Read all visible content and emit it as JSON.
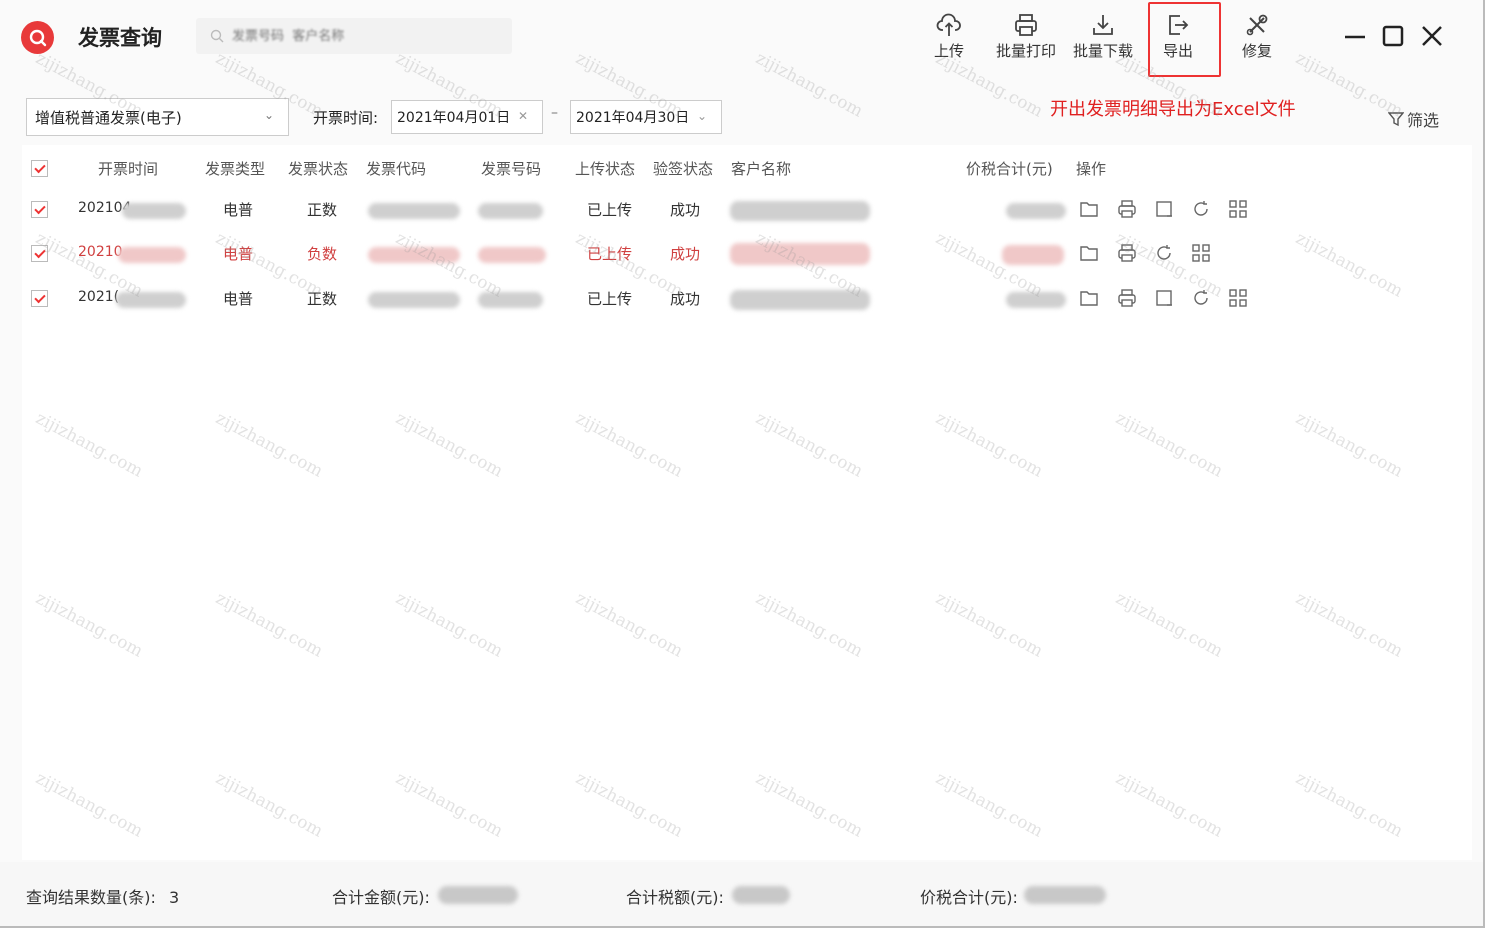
{
  "app": {
    "title": "发票查询"
  },
  "search": {
    "placeholder": "发票号码  客户名称"
  },
  "toolbar": {
    "upload": "上传",
    "batch_print": "批量打印",
    "batch_download": "批量下载",
    "export": "导出",
    "repair": "修复"
  },
  "annotation": "开出发票明细导出为Excel文件",
  "filters": {
    "invoice_type": "增值税普通发票(电子)",
    "date_label": "开票时间:",
    "start_date": "2021年04月01日",
    "date_separator": "–",
    "end_date": "2021年04月30日",
    "filter_button": "筛选"
  },
  "table": {
    "headers": [
      "开票时间",
      "发票类型",
      "发票状态",
      "发票代码",
      "发票号码",
      "上传状态",
      "验签状态",
      "客户名称",
      "价税合计(元)",
      "操作"
    ],
    "rows": [
      {
        "date": "202104",
        "type": "电普",
        "status": "正数",
        "upload": "已上传",
        "verify": "成功",
        "highlight": false
      },
      {
        "date": "20210",
        "type": "电普",
        "status": "负数",
        "upload": "已上传",
        "verify": "成功",
        "highlight": true
      },
      {
        "date": "2021(",
        "type": "电普",
        "status": "正数",
        "upload": "已上传",
        "verify": "成功",
        "highlight": false
      }
    ]
  },
  "footer": {
    "count_label": "查询结果数量(条):",
    "count_value": "3",
    "amount_label": "合计金额(元):",
    "tax_label": "合计税额(元):",
    "total_label": "价税合计(元):"
  },
  "watermark": "zijizhang.com",
  "colors": {
    "accent": "#e8393a",
    "negative_row": "#d04040",
    "annotation": "#e02020"
  }
}
